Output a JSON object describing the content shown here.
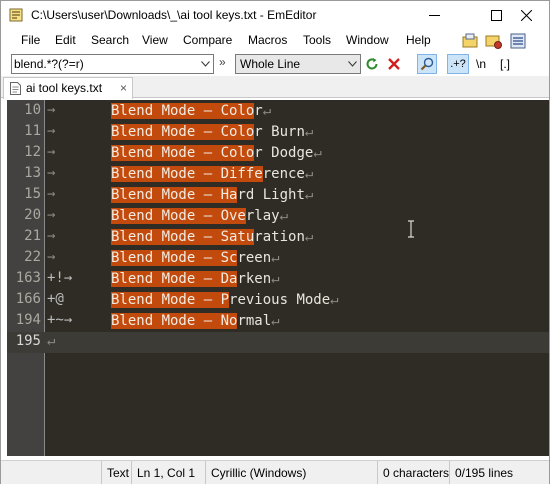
{
  "window": {
    "title": "C:\\Users\\user\\Downloads\\_\\ai tool keys.txt - EmEditor",
    "controls": {
      "minimize": "—",
      "maximize": "☐",
      "close": "✕"
    }
  },
  "menu": [
    "File",
    "Edit",
    "Search",
    "View",
    "Compare",
    "Macros",
    "Tools",
    "Window",
    "Help"
  ],
  "toolbar_icons": [
    "workspace-icon",
    "folder-settings-icon",
    "customize-icon"
  ],
  "find": {
    "query": "blend.*?(?=r)",
    "scope": "Whole Line",
    "next_label": "»",
    "regex_label": ".+?",
    "newline_label": "\\n",
    "escape_label": "[.]"
  },
  "tab": {
    "label": "ai tool keys.txt",
    "close": "×"
  },
  "editor": {
    "colors": {
      "background": "#2f2c25",
      "gutter": "#434240",
      "highlight": "#c24a0d",
      "text": "#e8e6dc"
    },
    "lines": [
      {
        "num": "10",
        "prefix": "→",
        "match": "Blend Mode – Colo",
        "rest": "r"
      },
      {
        "num": "11",
        "prefix": "→",
        "match": "Blend Mode – Colo",
        "rest": "r Burn"
      },
      {
        "num": "12",
        "prefix": "→",
        "match": "Blend Mode – Colo",
        "rest": "r Dodge"
      },
      {
        "num": "13",
        "prefix": "→",
        "match": "Blend Mode – Diffe",
        "rest": "rence"
      },
      {
        "num": "15",
        "prefix": "→",
        "match": "Blend Mode – Ha",
        "rest": "rd Light"
      },
      {
        "num": "20",
        "prefix": "→",
        "match": "Blend Mode – Ove",
        "rest": "rlay"
      },
      {
        "num": "21",
        "prefix": "→",
        "match": "Blend Mode – Satu",
        "rest": "ration"
      },
      {
        "num": "22",
        "prefix": "→",
        "match": "Blend Mode – Sc",
        "rest": "reen"
      },
      {
        "num": "163",
        "prefix": "+!→",
        "match": "Blend Mode – Da",
        "rest": "rken"
      },
      {
        "num": "166",
        "prefix": "+@",
        "match": "Blend Mode – P",
        "rest": "revious Mode"
      },
      {
        "num": "194",
        "prefix": "+~→",
        "match": "Blend Mode – No",
        "rest": "rmal"
      },
      {
        "num": "195",
        "prefix": "↵",
        "match": "",
        "rest": ""
      }
    ],
    "eol_mark": "↵"
  },
  "status": {
    "mode": "Text",
    "position": "Ln 1, Col 1",
    "encoding": "Cyrillic (Windows)",
    "characters": "0 characters",
    "lines": "0/195 lines"
  }
}
